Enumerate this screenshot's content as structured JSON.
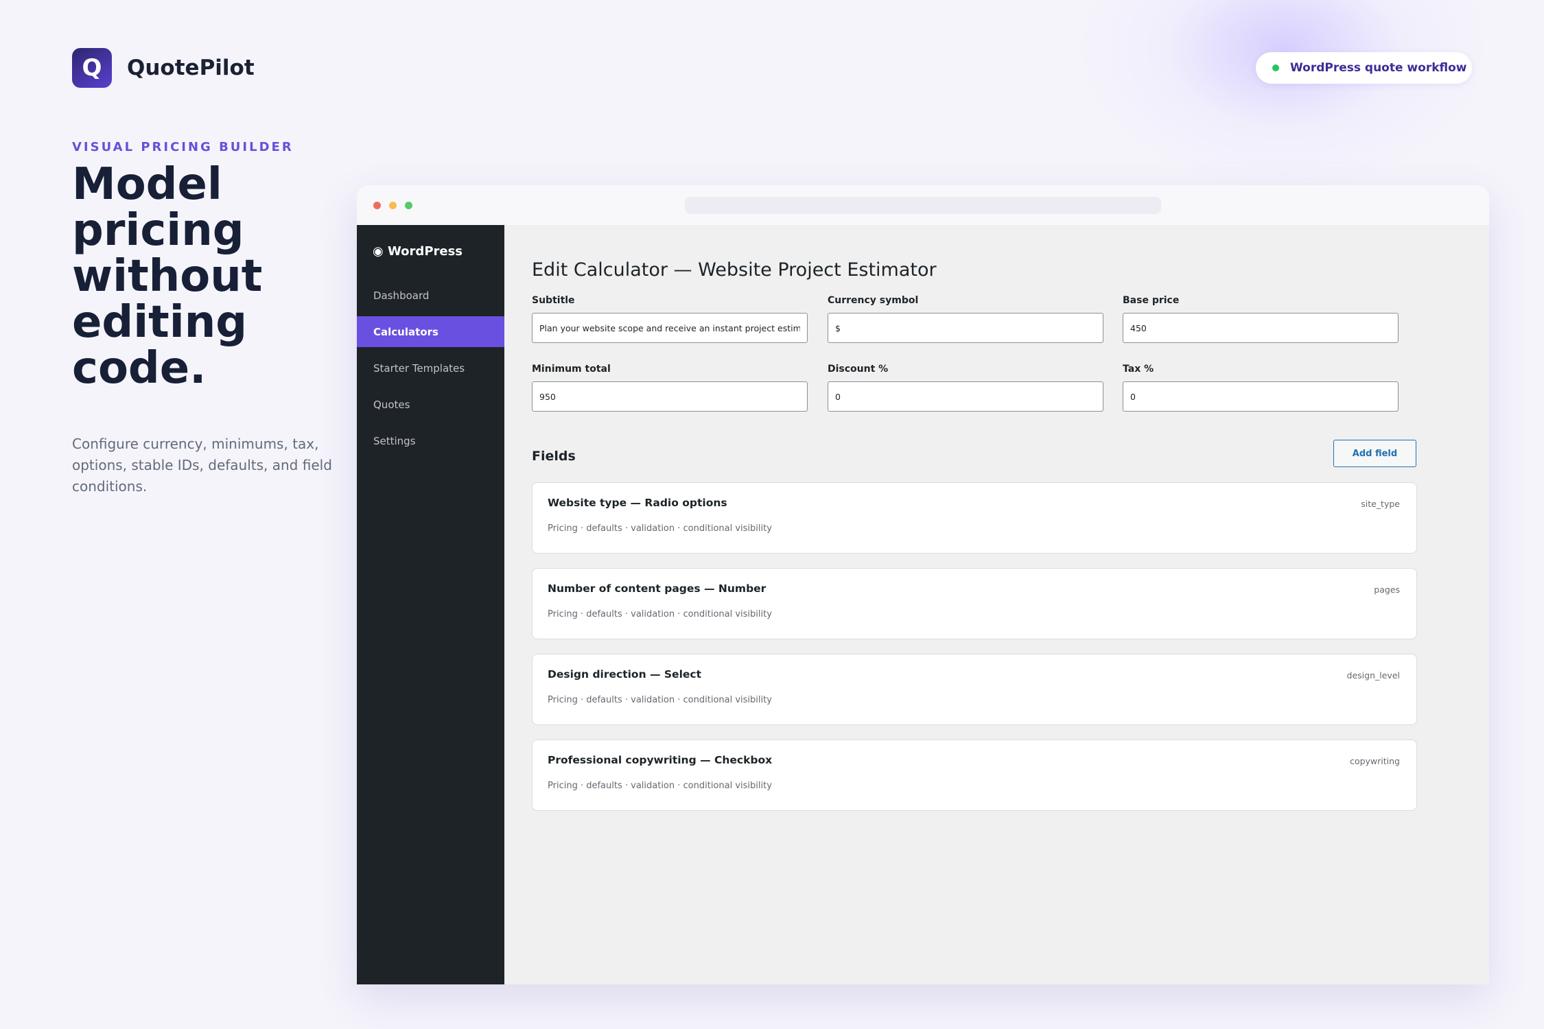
{
  "brand": {
    "logo_letter": "Q",
    "name": "QuotePilot"
  },
  "badge": {
    "label": "WordPress quote workflow",
    "dot_color": "#22c55e"
  },
  "hero": {
    "eyebrow": "VISUAL PRICING BUILDER",
    "headline": "Model pricing without editing code.",
    "description": "Configure currency, minimums, tax, options, stable IDs, defaults, and field conditions."
  },
  "colors": {
    "accent": "#6a50e0",
    "admin_sidebar": "#1d2327",
    "link_blue": "#2271b1"
  },
  "admin": {
    "site_title": "◉ WordPress",
    "menu": [
      {
        "label": "Dashboard",
        "active": false
      },
      {
        "label": "Calculators",
        "active": true
      },
      {
        "label": "Starter Templates",
        "active": false
      },
      {
        "label": "Quotes",
        "active": false
      },
      {
        "label": "Settings",
        "active": false
      }
    ],
    "page_title": "Edit Calculator — Website Project Estimator",
    "settings": [
      {
        "label": "Subtitle",
        "value": "Plan your website scope and receive an instant project estimate."
      },
      {
        "label": "Currency symbol",
        "value": "$"
      },
      {
        "label": "Base price",
        "value": "450"
      },
      {
        "label": "Minimum total",
        "value": "950"
      },
      {
        "label": "Discount %",
        "value": "0"
      },
      {
        "label": "Tax %",
        "value": "0"
      }
    ],
    "fields_heading": "Fields",
    "add_field_label": "Add field",
    "fields": [
      {
        "title": "Website type — Radio options",
        "meta": "Pricing · defaults · validation · conditional visibility",
        "id": "site_type"
      },
      {
        "title": "Number of content pages — Number",
        "meta": "Pricing · defaults · validation · conditional visibility",
        "id": "pages"
      },
      {
        "title": "Design direction — Select",
        "meta": "Pricing · defaults · validation · conditional visibility",
        "id": "design_level"
      },
      {
        "title": "Professional copywriting — Checkbox",
        "meta": "Pricing · defaults · validation · conditional visibility",
        "id": "copywriting"
      }
    ]
  }
}
